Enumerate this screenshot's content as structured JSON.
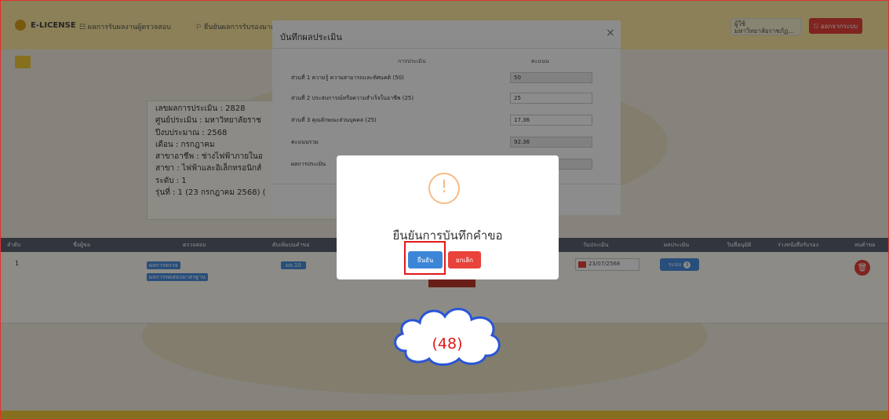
{
  "topbar": {
    "logo_text": "E-LICENSE",
    "nav1": "☷ ผลการรับผลงานผู้ตรวจสอบ",
    "nav2": "⚐ ยืนยันผลการรับรองมาตรฐาน",
    "user_line1": "ผู้ใช้",
    "user_line2": "มหาวิทยาลัยราชภัฏ...",
    "logout": "⎋ ออกจากระบบ"
  },
  "info": {
    "lines": [
      "เลขผลการประเมิน : 2828",
      "ศูนย์ประเมิน : มหาวิทยาลัยราช",
      "ปีงบประมาณ : 2568",
      "เดือน : กรกฎาคม",
      "สาขาอาชีพ : ช่างไฟฟ้าภายในอ",
      "สาขา : ไฟฟ้าและอิเล็กทรอนิกส์",
      "ระดับ : 1",
      "รุ่นที่ : 1 (23 กรกฎาคม 2568) ("
    ]
  },
  "table": {
    "headers": [
      "ลำดับ",
      "ชื่อผู้ขอ",
      "ตรวจสอบ",
      "ดับเพิ่มบนคำขอ",
      "วันประเมิน",
      "ผลประเมิน",
      "วันที่อนุมัติ",
      "ร่างหนังสือรับรอง",
      "ลบคำขอ"
    ],
    "row": {
      "index": "1",
      "chip1": "ผลการตรวจ",
      "chip2": "ผลการทดสอบมาตรฐาน",
      "chip3": "ผล.10",
      "date": "23/07/2568",
      "result_label": "ระบบ",
      "result_num": "3",
      "delete_icon": "🗑"
    }
  },
  "modal": {
    "title": "บันทึกผลประเมิน",
    "close": "×",
    "col_eval": "การประเมิน",
    "col_score": "คะแนน",
    "rows": [
      {
        "label": "ส่วนที่ 1 ความรู้ ความสามารถและทัศนคติ (50)",
        "value": "50",
        "readonly": true
      },
      {
        "label": "ส่วนที่ 2 ประสบการณ์หรือความสำเร็จในอาชีพ (25)",
        "value": "25",
        "readonly": false
      },
      {
        "label": "ส่วนที่ 3 คุณลักษณะส่วนบุคคล (25)",
        "value": "17.36",
        "readonly": false
      },
      {
        "label": "คะแนนรวม",
        "value": "92.36",
        "readonly": true
      },
      {
        "label": "ผลการประเมิน",
        "value": "",
        "readonly": true
      }
    ]
  },
  "alert": {
    "icon": "!",
    "title": "ยืนยันการบันทึกคำขอ",
    "confirm": "ยืนยัน",
    "cancel": "ยกเลิก"
  },
  "annotation": {
    "step": "(48)"
  },
  "colors": {
    "highlight": "#e01818",
    "confirm": "#3b86d8",
    "cancel": "#e8423a",
    "warning": "#f8bb86"
  }
}
